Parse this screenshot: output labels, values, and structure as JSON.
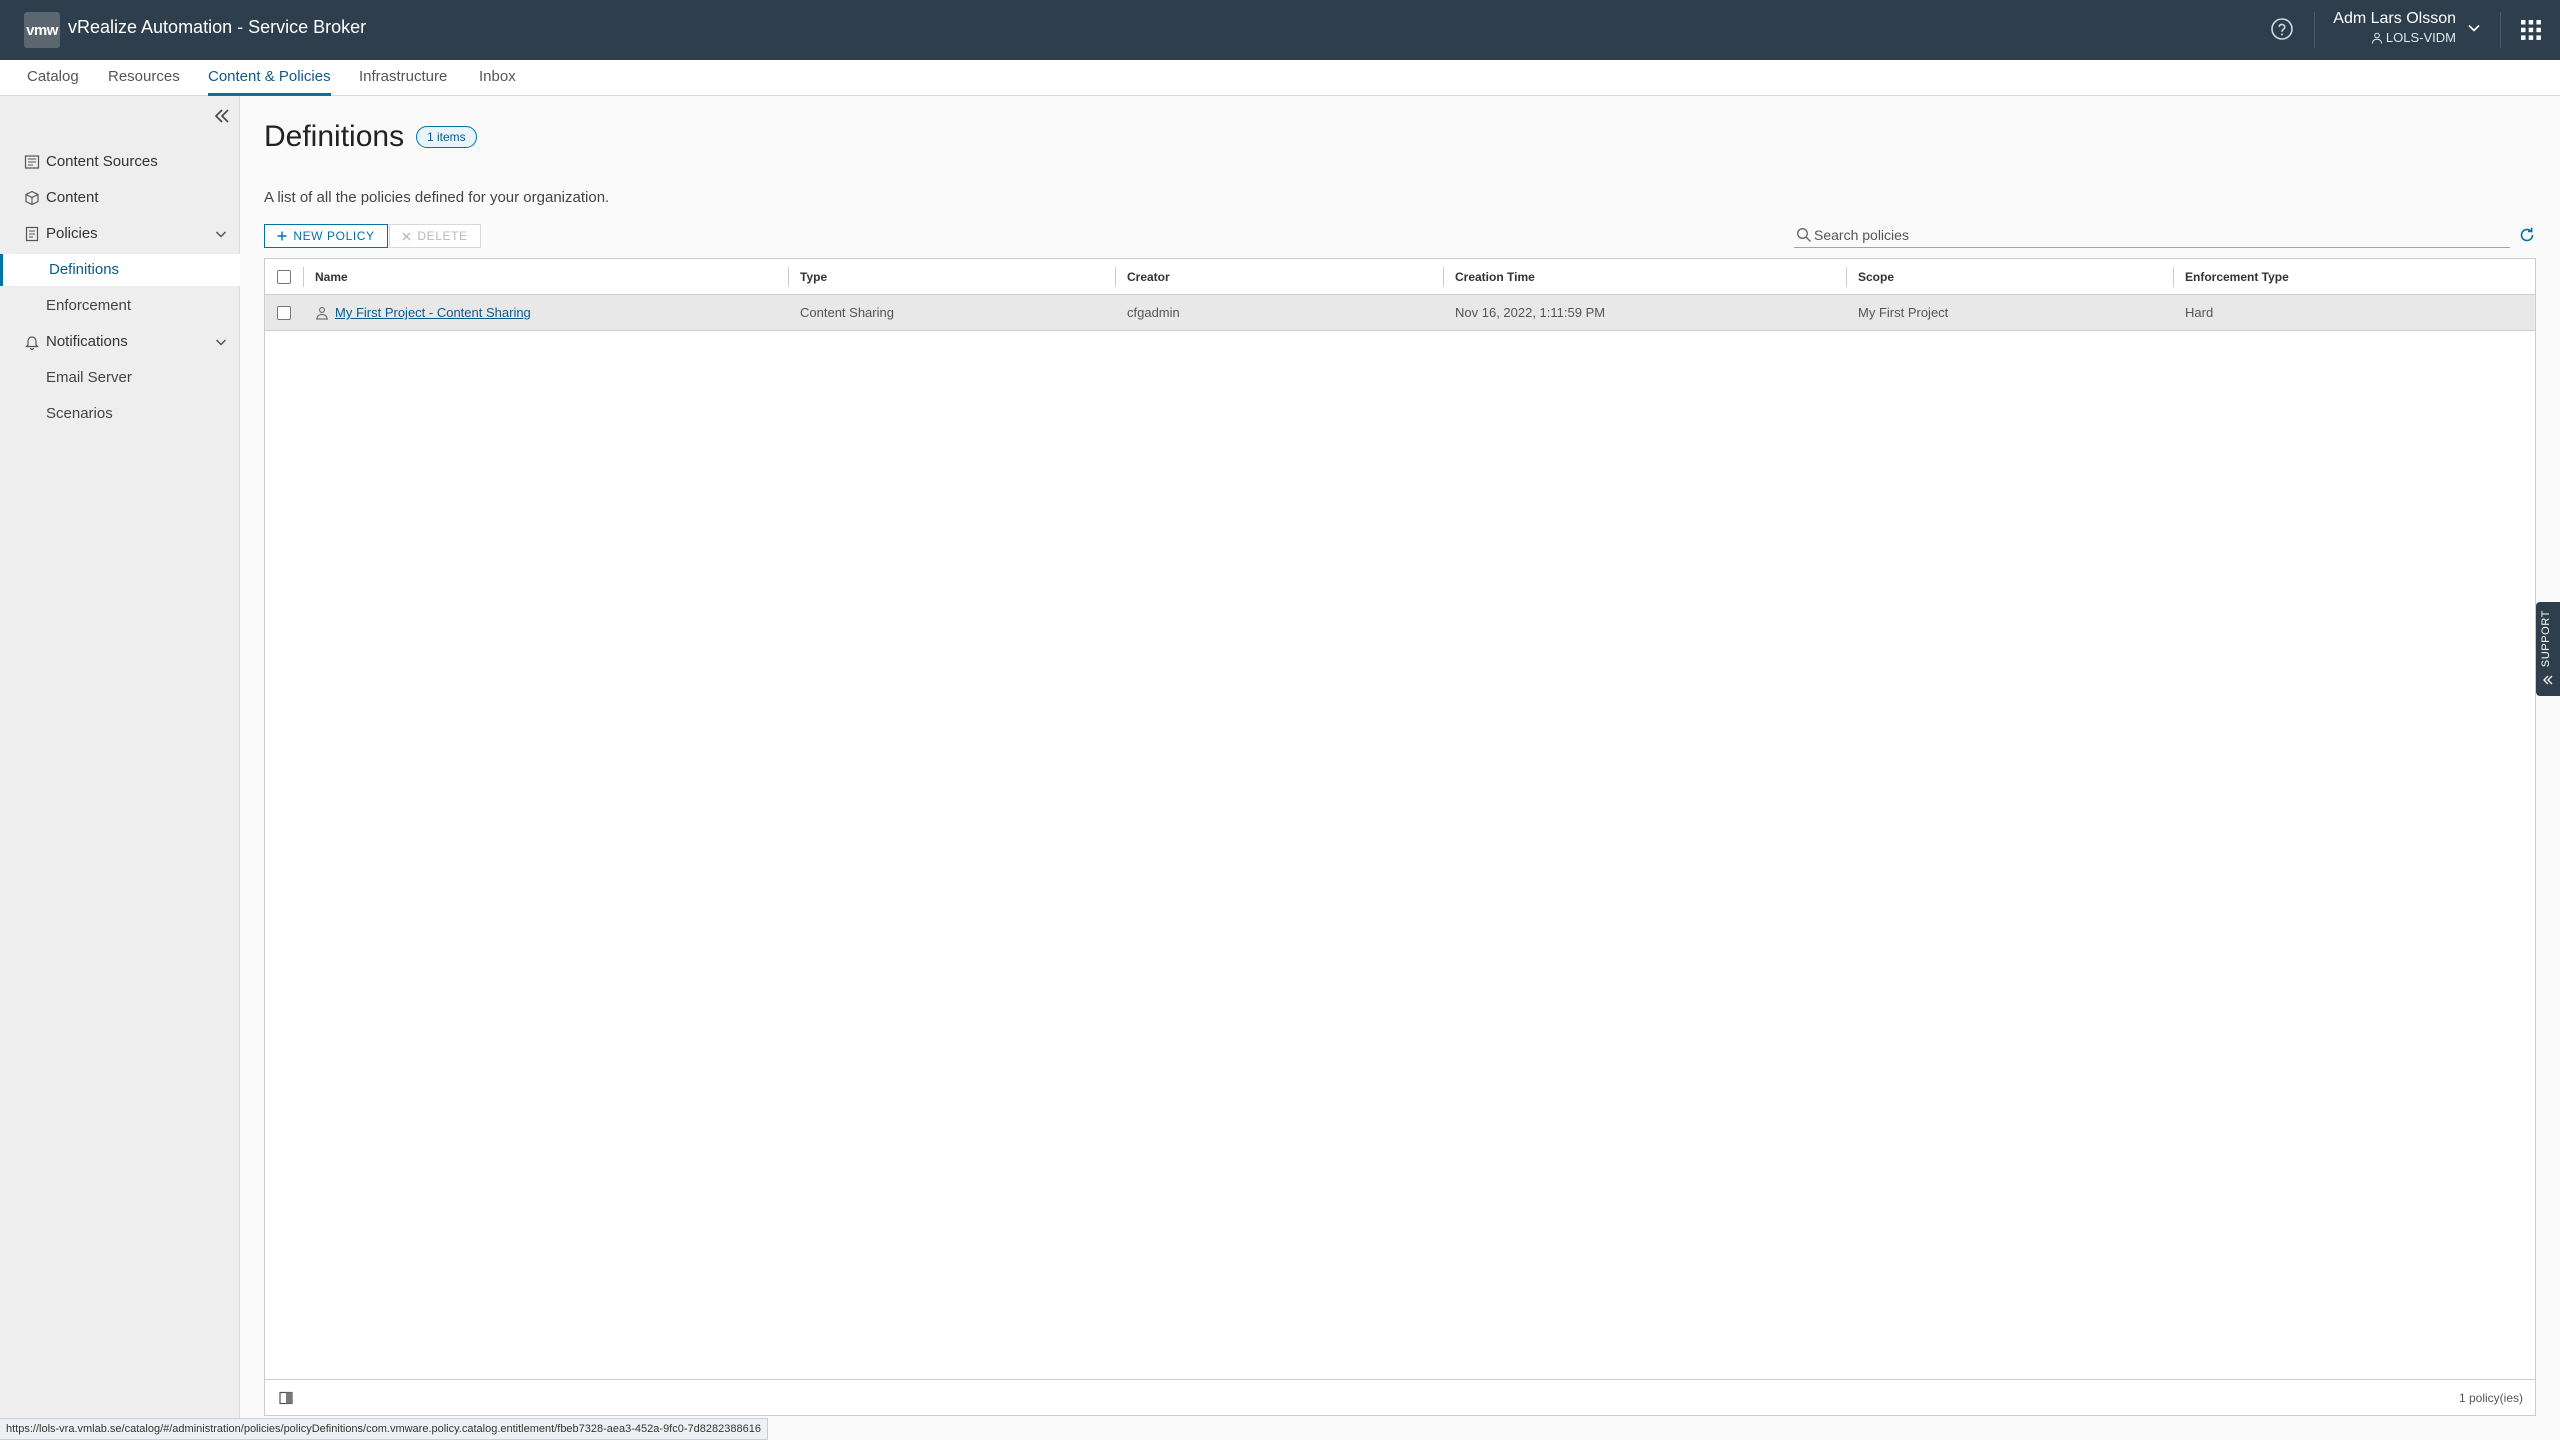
{
  "header": {
    "logo_text": "vmw",
    "app_title": "vRealize Automation - Service Broker",
    "user_name": "Adm Lars Olsson",
    "user_org": "LOLS-VIDM",
    "bg_color": "#2e3e4c"
  },
  "subnav": {
    "tabs": [
      {
        "label": "Catalog"
      },
      {
        "label": "Resources"
      },
      {
        "label": "Content & Policies",
        "active": true
      },
      {
        "label": "Infrastructure"
      },
      {
        "label": "Inbox"
      }
    ]
  },
  "sidebar": {
    "items": [
      {
        "label": "Content Sources",
        "icon": "content-sources-icon"
      },
      {
        "label": "Content",
        "icon": "content-icon"
      },
      {
        "label": "Policies",
        "icon": "policies-icon",
        "expanded": true,
        "children": [
          {
            "label": "Definitions",
            "active": true
          },
          {
            "label": "Enforcement"
          }
        ]
      },
      {
        "label": "Notifications",
        "icon": "bell-icon",
        "expanded": true,
        "children": [
          {
            "label": "Email Server"
          },
          {
            "label": "Scenarios"
          }
        ]
      }
    ]
  },
  "main": {
    "title": "Definitions",
    "count_badge": "1 items",
    "description": "A list of all the policies defined for your organization.",
    "new_button": "NEW POLICY",
    "delete_button": "DELETE",
    "search_placeholder": "Search policies",
    "columns": [
      "Name",
      "Type",
      "Creator",
      "Creation Time",
      "Scope",
      "Enforcement Type"
    ],
    "rows": [
      {
        "name": "My First Project - Content Sharing",
        "type": "Content Sharing",
        "creator": "cfgadmin",
        "creation_time": "Nov 16, 2022, 1:11:59 PM",
        "scope": "My First Project",
        "enforcement_type": "Hard"
      }
    ],
    "footer_count": "1 policy(ies)"
  },
  "support_label": "SUPPORT",
  "status_url": "https://lols-vra.vmlab.se/catalog/#/administration/policies/policyDefinitions/com.vmware.policy.catalog.entitlement/fbeb7328-aea3-452a-9fc0-7d8282388616",
  "colors": {
    "accent": "#0072a3",
    "link": "#0c5b8a"
  }
}
